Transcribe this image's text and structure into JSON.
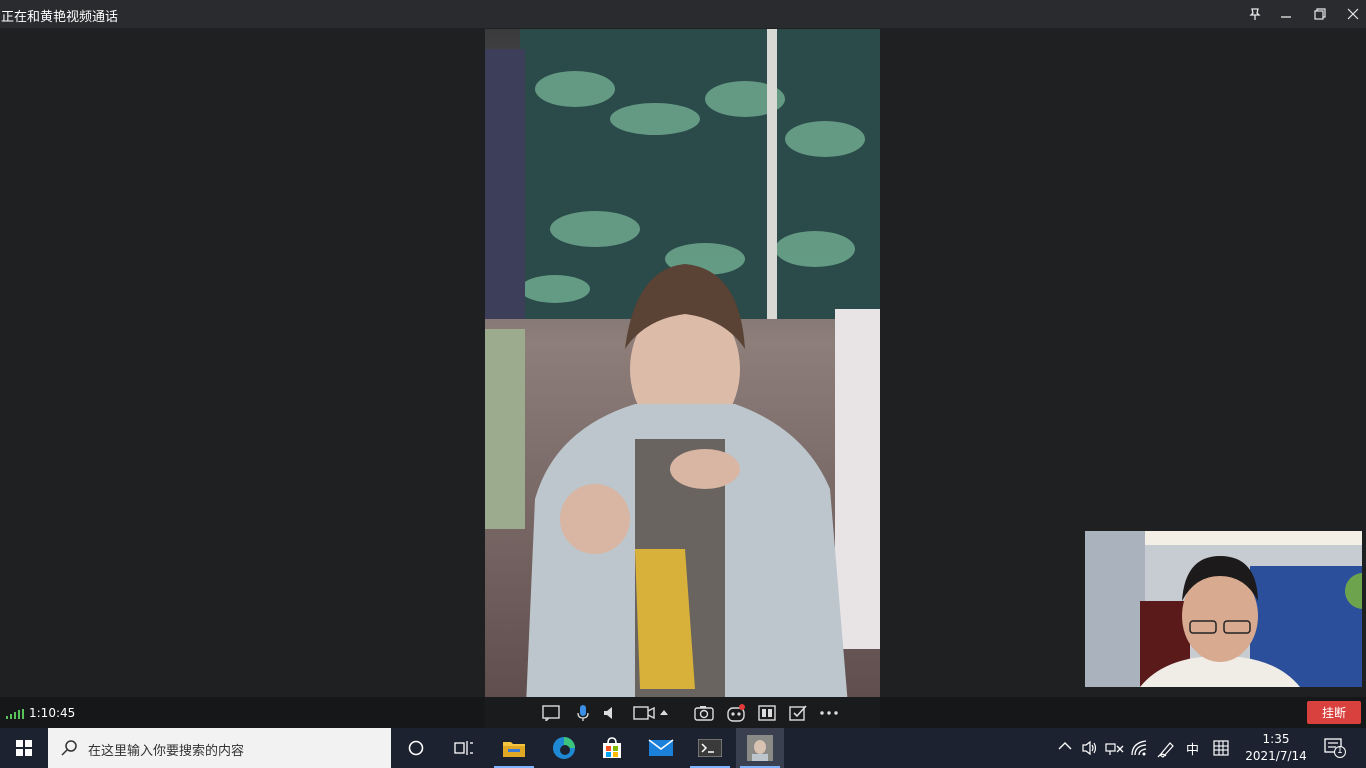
{
  "window": {
    "title": "正在和黄艳视频通话",
    "pin_icon": "pin-icon",
    "minimize_icon": "minimize-icon",
    "restore_icon": "restore-icon"
  },
  "call": {
    "timer": "1:10:45",
    "hangup_label": "挂断",
    "controls": [
      "message-icon",
      "microphone-icon",
      "speaker-icon",
      "camera-icon",
      "dropdown-arrow-icon",
      "screenshot-icon",
      "effects-icon",
      "screen-share-icon",
      "whiteboard-icon",
      "more-icon"
    ]
  },
  "taskbar": {
    "search_placeholder": "在这里输入你要搜索的内容",
    "tray_ime_lang": "中",
    "clock_time": "1:35",
    "clock_date": "2021/7/14",
    "notification_count": "1"
  },
  "colors": {
    "hangup": "#d9413e",
    "signal": "#5ac05a",
    "taskbar": "#1d2230",
    "accent_underline": "#7fb3ff"
  }
}
